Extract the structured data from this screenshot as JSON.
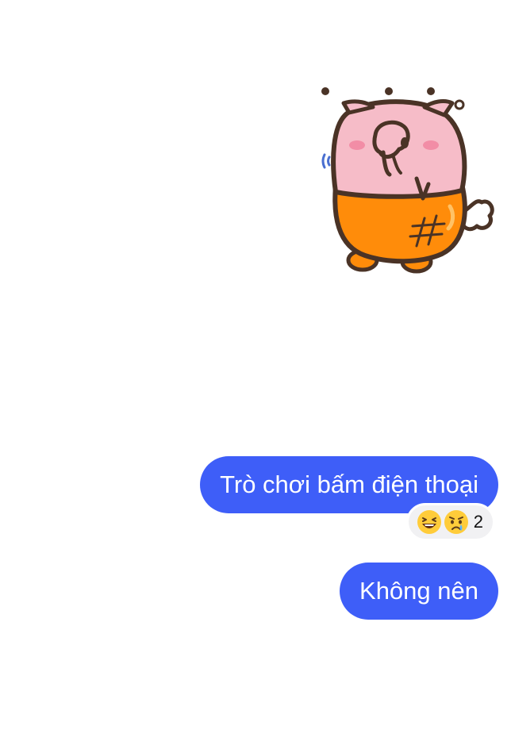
{
  "messages": [
    {
      "type": "sticker",
      "sticker_icon": "pig-sticker-icon"
    },
    {
      "type": "text",
      "text": "Trò chơi bấm điện thoại",
      "reactions": {
        "emojis": [
          "laughing-emoji-icon",
          "crying-emoji-icon"
        ],
        "count": "2"
      }
    },
    {
      "type": "text",
      "text": "Không nên"
    }
  ],
  "colors": {
    "bubble": "#3e5ef8",
    "bubble_text": "#ffffff",
    "reaction_bg": "#f1f1f3",
    "background": "#ffffff"
  }
}
